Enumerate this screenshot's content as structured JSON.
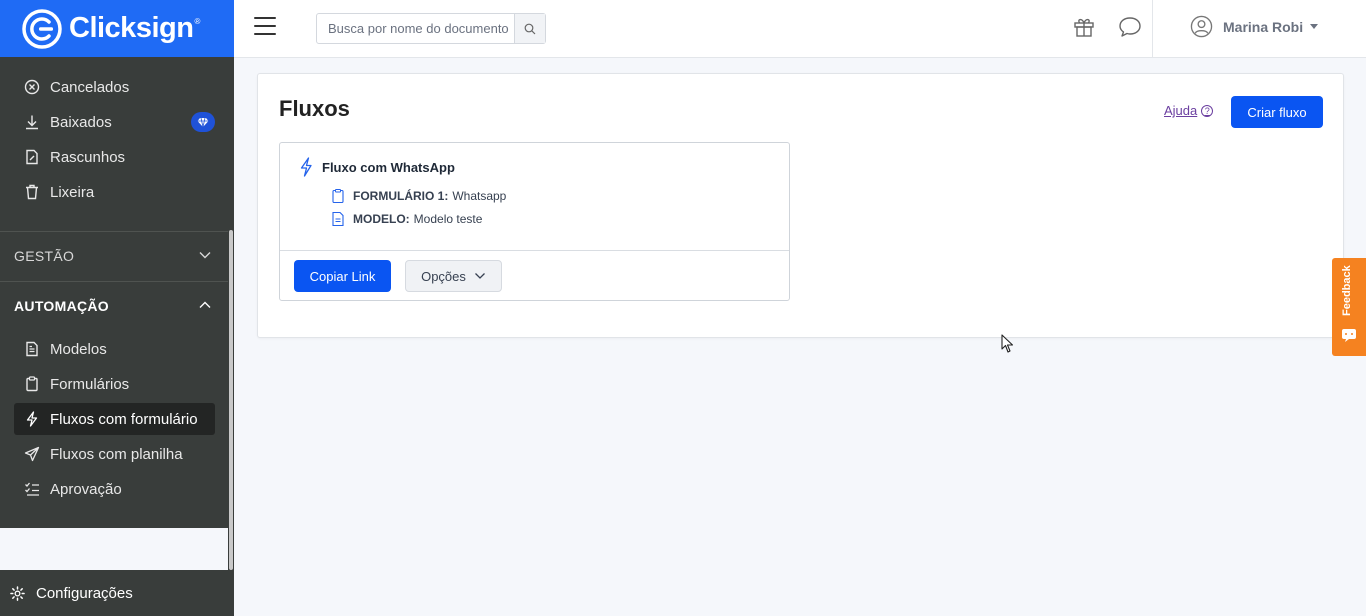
{
  "brand": {
    "name": "Clicksign",
    "reg": "®"
  },
  "sidebar": {
    "items_top": [
      {
        "label": "Cancelados",
        "icon": "cancel-circle-icon"
      },
      {
        "label": "Baixados",
        "icon": "download-icon",
        "badge": "diamond-icon"
      },
      {
        "label": "Rascunhos",
        "icon": "draft-icon"
      },
      {
        "label": "Lixeira",
        "icon": "trash-icon"
      }
    ],
    "section_gestao": "GESTÃO",
    "section_automacao": "AUTOMAÇÃO",
    "items_automacao": [
      {
        "label": "Modelos",
        "icon": "template-icon"
      },
      {
        "label": "Formulários",
        "icon": "clipboard-icon"
      },
      {
        "label": "Fluxos com formulário",
        "icon": "lightning-icon",
        "active": true
      },
      {
        "label": "Fluxos com planilha",
        "icon": "paper-plane-icon"
      },
      {
        "label": "Aprovação",
        "icon": "checklist-icon"
      }
    ],
    "settings_label": "Configurações"
  },
  "topbar": {
    "search_placeholder": "Busca por nome do documento",
    "user_name": "Marina Robi"
  },
  "main": {
    "title": "Fluxos",
    "help_label": "Ajuda",
    "create_button": "Criar fluxo",
    "flow": {
      "name": "Fluxo com WhatsApp",
      "form_key": "FORMULÁRIO 1:",
      "form_value": "Whatsapp",
      "model_key": "MODELO:",
      "model_value": "Modelo teste",
      "copy_button": "Copiar Link",
      "options_button": "Opções"
    }
  },
  "feedback_label": "Feedback",
  "colors": {
    "brand_blue": "#1f6bf5",
    "primary_button": "#0a55f2",
    "sidebar_bg": "#393d3b",
    "feedback": "#f58220"
  }
}
